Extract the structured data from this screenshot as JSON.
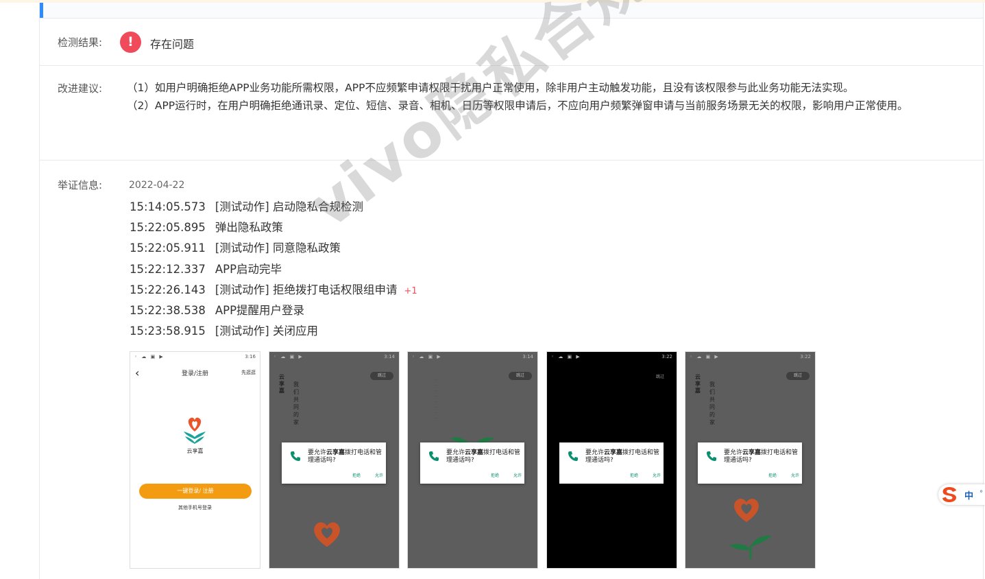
{
  "labels": {
    "result": "检测结果:",
    "advice": "改进建议:",
    "evidence": "举证信息:"
  },
  "result": {
    "icon": "exclamation-icon",
    "icon_glyph": "!",
    "text": "存在问题",
    "color": "#f04b5a"
  },
  "advice": {
    "items": [
      "（1）如用户明确拒绝APP业务功能所需权限，APP不应频繁申请权限干扰用户正常使用，除非用户主动触发功能，且没有该权限参与此业务功能无法实现。",
      "（2）APP运行时，在用户明确拒绝通讯录、定位、短信、录音、相机、日历等权限申请后，不应向用户频繁弹窗申请与当前服务场景无关的权限，影响用户正常使用。"
    ]
  },
  "evidence": {
    "date": "2022-04-22",
    "logs": [
      {
        "time": "15:14:05.573",
        "text": "[测试动作] 启动隐私合规检测",
        "badge": ""
      },
      {
        "time": "15:22:05.895",
        "text": "弹出隐私政策",
        "badge": ""
      },
      {
        "time": "15:22:05.911",
        "text": "[测试动作] 同意隐私政策",
        "badge": ""
      },
      {
        "time": "15:22:12.337",
        "text": "APP启动完毕",
        "badge": ""
      },
      {
        "time": "15:22:26.143",
        "text": "[测试动作] 拒绝拨打电话权限组申请",
        "badge": "+1"
      },
      {
        "time": "15:22:38.538",
        "text": "APP提醒用户登录",
        "badge": ""
      },
      {
        "time": "15:23:58.915",
        "text": "[测试动作] 关闭应用",
        "badge": ""
      }
    ],
    "screenshots": {
      "login": {
        "status_right": "3:16",
        "title": "登录/注册",
        "skip": "先逛逛",
        "app_name": "云享嘉",
        "login_button": "一键登录/ 注册",
        "other_login": "其他手机号登录"
      },
      "dialogs": [
        {
          "status_right": "3:14",
          "skip": "跳过",
          "brand": "云享嘉",
          "slogan": "我们共同的家",
          "title_pre": "要允许",
          "app": "云享嘉",
          "title_post": "拨打电话和管理通话吗?",
          "deny": "拒绝",
          "allow": "允许"
        },
        {
          "status_right": "3:14",
          "skip": "跳过",
          "title_pre": "要允许",
          "app": "云享嘉",
          "title_post": "拨打电话和管理通话吗?",
          "deny": "拒绝",
          "allow": "允许"
        },
        {
          "status_right": "3:22",
          "skip": "跳过",
          "title_pre": "要允许",
          "app": "云享嘉",
          "title_post": "拨打电话和管理通话吗?",
          "deny": "拒绝",
          "allow": "允许"
        },
        {
          "status_right": "3:22",
          "skip": "跳过",
          "brand": "云享嘉",
          "slogan": "我们共同的家",
          "title_pre": "要允许",
          "app": "云享嘉",
          "title_post": "拨打电话和管理通话吗?",
          "deny": "拒绝",
          "allow": "允许"
        }
      ]
    }
  },
  "watermark": "vivo隐私合规检测",
  "ime": {
    "icon": "sogou-s-icon",
    "text": "中"
  },
  "colors": {
    "accent": "#2f8cff",
    "alert": "#f04b5a",
    "login_button": "#f39c12",
    "dialog_action": "#0a8f6f"
  }
}
